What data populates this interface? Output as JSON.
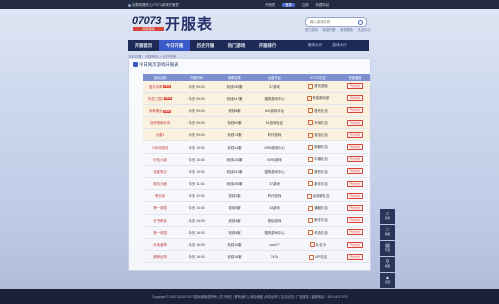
{
  "topbar": {
    "left_text": "加载收藏网上07073游戏开服表",
    "right": [
      "开服表",
      "登录",
      "注册",
      "收藏网站"
    ]
  },
  "header": {
    "logo_number": "07073",
    "logo_sub": "网页游戏",
    "title": "开服表",
    "search_placeholder": "输入游戏名称",
    "hot_links": [
      "热门游戏",
      "新游开服",
      "新游预告",
      "礼包中心"
    ]
  },
  "nav": {
    "items": [
      "开服首页",
      "今日开服",
      "历史开服",
      "热门游戏",
      "开服排行"
    ],
    "extra": [
      "服务大厅",
      "游戏大厅"
    ]
  },
  "breadcrumb": "当前位置：开服首页 > 今日开服",
  "section_title": "今日网页游戏开服表",
  "table": {
    "headers": [
      "游戏名称",
      "开服时间",
      "新服名称",
      "运营平台",
      "07073礼包",
      "快速通道"
    ],
    "rows": [
      {
        "name": "蓝月传奇",
        "tag": "NEW",
        "time": "今天 09:00",
        "server": "双线159服",
        "platform": "37游戏",
        "gift": "首充奖励",
        "action": "开始游戏",
        "hl": true
      },
      {
        "name": "热血三国3",
        "tag": "NEW",
        "time": "今天 09:00",
        "server": "双线447服",
        "platform": "搜狗游戏中心",
        "gift": "有奖新玩家",
        "action": "开始游戏",
        "hl": true
      },
      {
        "name": "传奇霸业",
        "tag": "NEW",
        "time": "今天 09:00",
        "server": "双线6服",
        "platform": "602游戏平台",
        "gift": "首充礼包",
        "action": "开始游戏",
        "hl": true
      },
      {
        "name": "剑侠情缘外传",
        "tag": "",
        "time": "今天 09:00",
        "server": "双线90服",
        "platform": "51游戏社区",
        "gift": "天域礼包",
        "action": "开始游戏",
        "hl": true
      },
      {
        "name": "大唐3",
        "tag": "",
        "time": "今天 09:00",
        "server": "双线74服",
        "platform": "时代游戏",
        "gift": "激活礼包",
        "action": "开始游戏",
        "hl": true
      },
      {
        "name": "少年西游传",
        "tag": "",
        "time": "今天 10:00",
        "server": "双线14服",
        "platform": "4399游戏中心",
        "gift": "新服礼包",
        "action": "开始游戏",
        "hl": false
      },
      {
        "name": "乐伍九城",
        "tag": "",
        "time": "今天 10:00",
        "server": "双线126服",
        "platform": "9090游戏",
        "gift": "中通礼包",
        "action": "开始游戏",
        "hl": false
      },
      {
        "name": "流星笔记",
        "tag": "",
        "time": "今天 10:00",
        "server": "双线491服",
        "platform": "搜狗游戏中心",
        "gift": "首充礼包",
        "action": "开始游戏",
        "hl": false
      },
      {
        "name": "魔法元器",
        "tag": "",
        "time": "今天 11:00",
        "server": "双线266服",
        "platform": "37游戏",
        "gift": "新手礼包",
        "action": "开始游戏",
        "hl": false
      },
      {
        "name": "倚长街",
        "tag": "",
        "time": "今天 12:00",
        "server": "双线2服",
        "platform": "时代游戏",
        "gift": "活动新礼包",
        "action": "开始游戏",
        "hl": false
      },
      {
        "name": "第一帝国",
        "tag": "",
        "time": "今天 14:00",
        "server": "双线9服",
        "platform": "43游戏",
        "gift": "通服礼包",
        "action": "开始游戏",
        "hl": false
      },
      {
        "name": "天书奇谈",
        "tag": "",
        "time": "今天 15:00",
        "server": "双线4服",
        "platform": "快玩游戏",
        "gift": "新手礼包",
        "action": "开始游戏",
        "hl": false
      },
      {
        "name": "第一帝国",
        "tag": "",
        "time": "今天 16:00",
        "server": "双线9服",
        "platform": "搜狗游戏中心",
        "gift": "风流礼包",
        "action": "开始游戏",
        "hl": false
      },
      {
        "name": "天地诸神",
        "tag": "",
        "time": "今天 16:00",
        "server": "双线10服",
        "platform": "wan77",
        "gift": "礼包卡",
        "action": "开始游戏",
        "hl": false
      },
      {
        "name": "魔神战场",
        "tag": "",
        "time": "今天 16:00",
        "server": "双线16服",
        "platform": "7k7k",
        "gift": "VIP礼包",
        "action": "开始游戏",
        "hl": false
      }
    ]
  },
  "sidebar": [
    {
      "icon": "⌕",
      "label": "搜索"
    },
    {
      "icon": "☆",
      "label": "收藏"
    },
    {
      "icon": "▤",
      "label": "开服"
    },
    {
      "icon": "⚲",
      "label": "客服"
    },
    {
      "icon": "▲",
      "label": "顶部"
    }
  ],
  "footer": "Copyright © 2002-2015 07073游戏网版权所有 | 关于我们 | 联系我们 | 网站地图 | 商务合作 | 意见反馈 | 广告服务 | 客服电话：400-44-07073"
}
